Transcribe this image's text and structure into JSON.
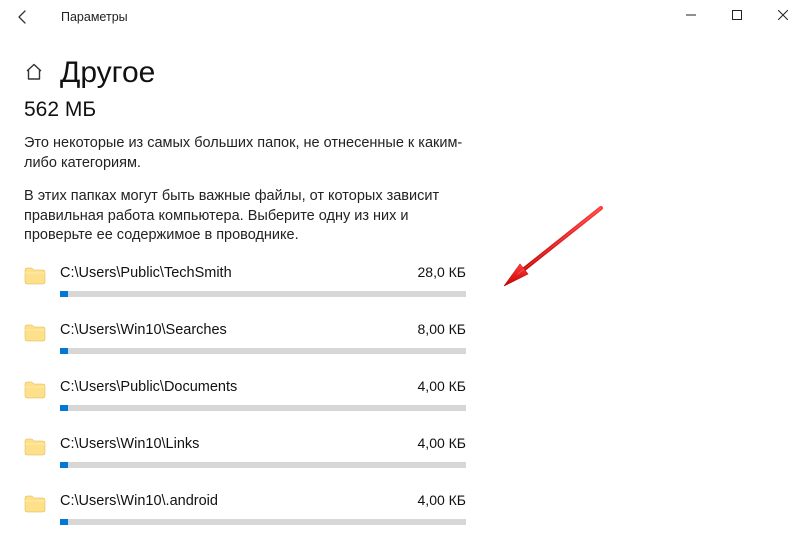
{
  "window": {
    "title": "Параметры"
  },
  "page": {
    "heading": "Другое",
    "total_size": "562 МБ",
    "desc1": "Это некоторые из самых больших папок, не отнесенные к каким-либо категориям.",
    "desc2": "В этих папках могут быть важные файлы, от которых зависит правильная работа компьютера. Выберите одну из них и проверьте ее содержимое в проводнике."
  },
  "folders": [
    {
      "path": "C:\\Users\\Public\\TechSmith",
      "size": "28,0 КБ",
      "fill_pct": 2
    },
    {
      "path": "C:\\Users\\Win10\\Searches",
      "size": "8,00 КБ",
      "fill_pct": 2
    },
    {
      "path": "C:\\Users\\Public\\Documents",
      "size": "4,00 КБ",
      "fill_pct": 2
    },
    {
      "path": "C:\\Users\\Win10\\Links",
      "size": "4,00 КБ",
      "fill_pct": 2
    },
    {
      "path": "C:\\Users\\Win10\\.android",
      "size": "4,00 КБ",
      "fill_pct": 2
    }
  ]
}
